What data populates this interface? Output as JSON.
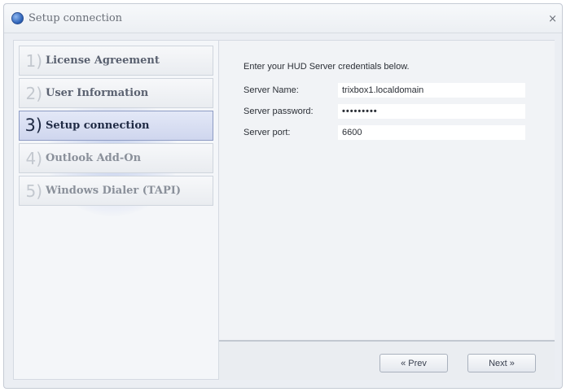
{
  "window": {
    "title": "Setup connection",
    "close_label": "×"
  },
  "steps": [
    {
      "num": "1)",
      "label": "License Agreement",
      "state": "done"
    },
    {
      "num": "2)",
      "label": "User Information",
      "state": "done"
    },
    {
      "num": "3)",
      "label": "Setup connection",
      "state": "active"
    },
    {
      "num": "4)",
      "label": "Outlook Add-On",
      "state": "pending"
    },
    {
      "num": "5)",
      "label": "Windows Dialer (TAPI)",
      "state": "pending"
    }
  ],
  "form": {
    "intro": "Enter your HUD Server credentials below.",
    "server_name_label": "Server Name:",
    "server_name_value": "trixbox1.localdomain",
    "server_password_label": "Server password:",
    "server_password_value": "•••••••••",
    "server_port_label": "Server port:",
    "server_port_value": "6600"
  },
  "buttons": {
    "prev": "« Prev",
    "next": "Next »"
  },
  "colors": {
    "active_step_bg": "#d7ddf1",
    "window_bg": "#ebeef3",
    "icon_blue": "#2e63b8"
  }
}
